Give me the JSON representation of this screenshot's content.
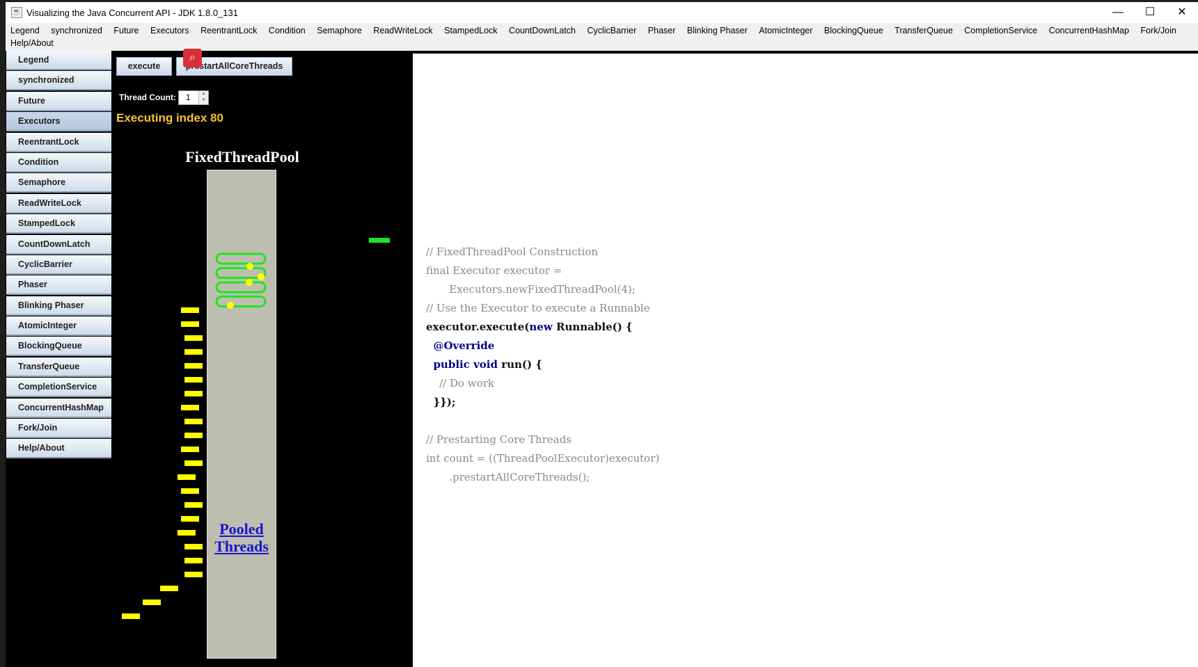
{
  "window": {
    "title": "Visualizing the Java Concurrent API - JDK 1.8.0_131",
    "minimize": "—",
    "maximize": "☐",
    "close": "✕"
  },
  "menu": [
    "Legend",
    "synchronized",
    "Future",
    "Executors",
    "ReentrantLock",
    "Condition",
    "Semaphore",
    "ReadWriteLock",
    "StampedLock",
    "CountDownLatch",
    "CyclicBarrier",
    "Phaser",
    "Blinking Phaser",
    "AtomicInteger",
    "BlockingQueue",
    "TransferQueue",
    "CompletionService",
    "ConcurrentHashMap",
    "Fork/Join",
    "Help/About"
  ],
  "sidebar": {
    "selected": "Executors",
    "items": [
      "Legend",
      "synchronized",
      "Future",
      "Executors",
      "ReentrantLock",
      "Condition",
      "Semaphore",
      "ReadWriteLock",
      "StampedLock",
      "CountDownLatch",
      "CyclicBarrier",
      "Phaser",
      "Blinking Phaser",
      "AtomicInteger",
      "BlockingQueue",
      "TransferQueue",
      "CompletionService",
      "ConcurrentHashMap",
      "Fork/Join",
      "Help/About"
    ]
  },
  "controls": {
    "execute": "execute",
    "prestart": "prestartAllCoreThreads",
    "thread_count_label": "Thread Count:",
    "thread_count": "1",
    "status": "Executing index 80"
  },
  "visual": {
    "pool_title": "FixedThreadPool",
    "pool_label_1": "Pooled",
    "pool_label_2": "Threads",
    "pool_threads": 4,
    "queued_tasks": 23,
    "completed_tasks": 1,
    "colors": {
      "task": "#ffff00",
      "thread": "#1ee61e",
      "pool": "#bebeb0",
      "status": "#f5c332"
    }
  },
  "code": [
    {
      "cls": "c",
      "text": "// FixedThreadPool Construction"
    },
    {
      "cls": "c",
      "text": "final Executor executor ="
    },
    {
      "cls": "c",
      "text": "       Executors.newFixedThreadPool(4);"
    },
    {
      "cls": "c",
      "text": "// Use the Executor to execute a Runnable"
    },
    {
      "cls": "b",
      "parts": [
        [
          "b",
          "executor.execute("
        ],
        [
          "k",
          "new"
        ],
        [
          "b",
          " Runnable() {"
        ]
      ]
    },
    {
      "cls": "k",
      "text": "  @Override"
    },
    {
      "cls": "b",
      "parts": [
        [
          "k",
          "  public void"
        ],
        [
          "b",
          " run() {"
        ]
      ]
    },
    {
      "cls": "c",
      "text": "    // Do work"
    },
    {
      "cls": "b",
      "text": "  }});"
    },
    {
      "cls": "c",
      "text": ""
    },
    {
      "cls": "c",
      "text": "// Prestarting Core Threads"
    },
    {
      "cls": "c",
      "text": "int count = ((ThreadPoolExecutor)executor)"
    },
    {
      "cls": "c",
      "text": "       .prestartAllCoreThreads();"
    }
  ]
}
